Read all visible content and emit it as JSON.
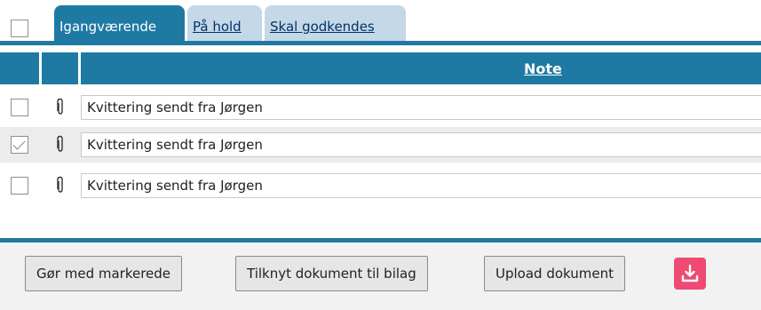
{
  "tabs": [
    {
      "label": "Igangværende",
      "active": true
    },
    {
      "label": "På hold",
      "active": false
    },
    {
      "label": "Skal godkendes",
      "active": false
    }
  ],
  "table": {
    "columns": [
      "",
      "",
      "Note"
    ],
    "rows": [
      {
        "checked": false,
        "icon": "paperclip-icon",
        "note": "Kvittering sendt fra Jørgen"
      },
      {
        "checked": true,
        "icon": "paperclip-icon",
        "note": "Kvittering sendt fra Jørgen"
      },
      {
        "checked": false,
        "icon": "paperclip-icon",
        "note": "Kvittering sendt fra Jørgen"
      }
    ]
  },
  "footer": {
    "buttons": [
      {
        "label": "Gør med markerede"
      },
      {
        "label": "Tilknyt dokument til bilag"
      },
      {
        "label": "Upload dokument"
      }
    ],
    "download_icon": "download-icon"
  },
  "colors": {
    "accent": "#1f7aa3",
    "inactive_tab": "#c5d8e8",
    "download_button": "#ee4a72"
  }
}
